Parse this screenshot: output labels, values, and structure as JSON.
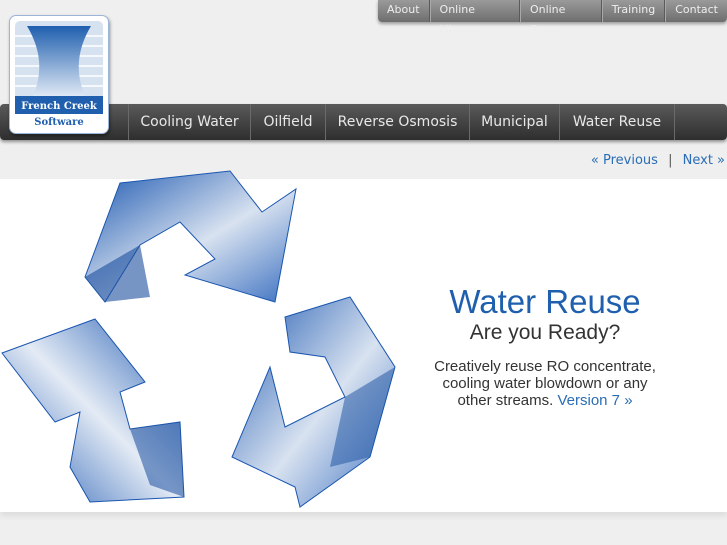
{
  "top_nav": [
    "About",
    "Online Library",
    "Online Store",
    "Training",
    "Contact"
  ],
  "logo": {
    "line1": "French Creek",
    "line2": "Software"
  },
  "main_nav": [
    "Cooling Water",
    "Oilfield",
    "Reverse Osmosis",
    "Municipal",
    "Water Reuse"
  ],
  "pager": {
    "previous": "« Previous",
    "separator": "|",
    "next": "Next »"
  },
  "banner": {
    "title": "Water Reuse",
    "subtitle": "Are you Ready?",
    "body": "Creatively reuse RO concentrate, cooling water blowdown or any other streams.",
    "link": "Version 7 »"
  },
  "colors": {
    "accent": "#1f5fae",
    "link": "#2a6db5"
  }
}
